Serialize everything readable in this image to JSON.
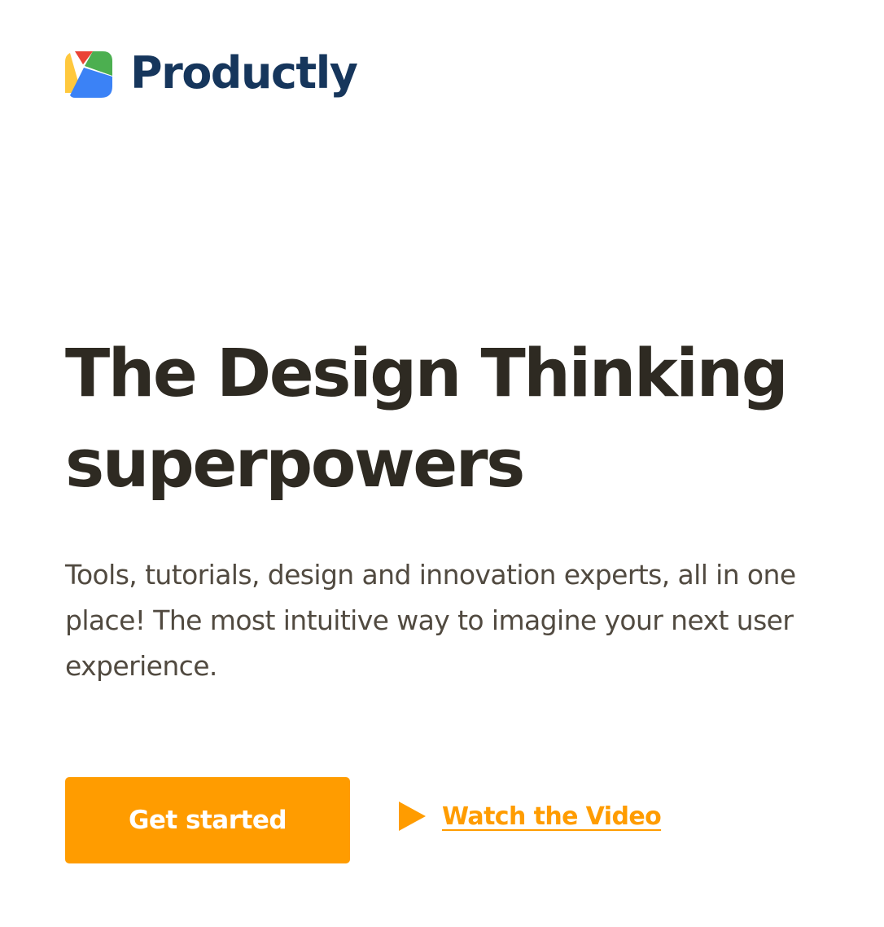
{
  "brand": {
    "name": "Productly",
    "logo_icon": "multicolor-petal-logo-icon",
    "text_color": "#16365c",
    "logo_colors": {
      "red": "#ea4335",
      "green": "#4caf50",
      "yellow": "#ffc83d",
      "blue": "#3b82f6"
    }
  },
  "hero": {
    "headline": "The Design Thinking superpowers",
    "headline_color": "#2e2a22",
    "subtext": "Tools, tutorials, design and innovation experts, all in one place! The most intuitive way to imagine your next user experience.",
    "subtext_color": "#514a40"
  },
  "actions": {
    "primary_label": "Get started",
    "primary_bg": "#ff9c00",
    "secondary_label": "Watch the Video",
    "secondary_icon": "play-icon",
    "secondary_color": "#ff9c00"
  }
}
